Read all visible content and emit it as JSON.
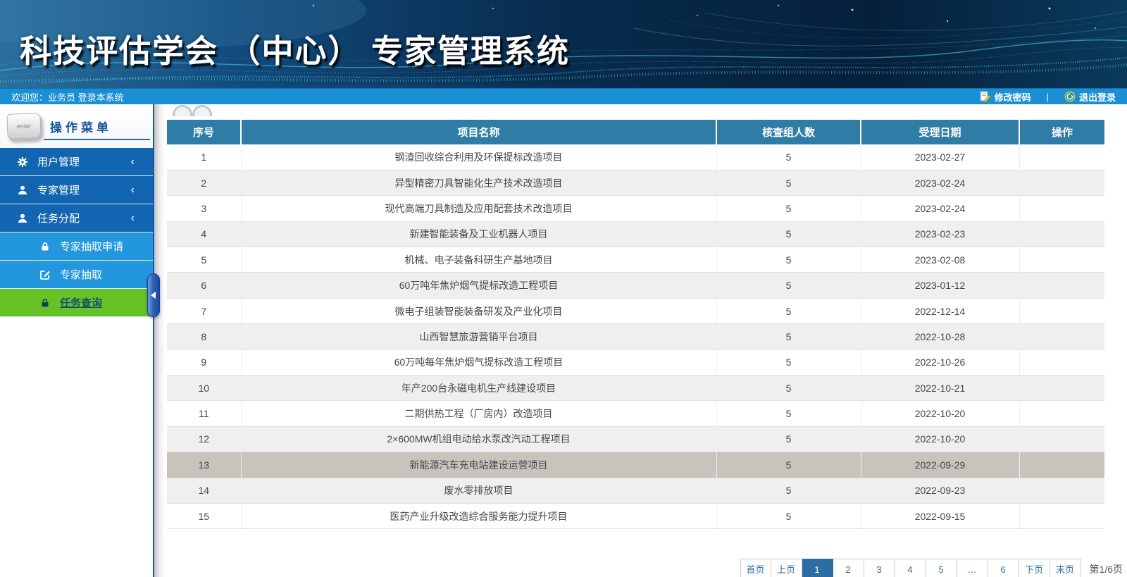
{
  "banner": {
    "title": "科技评估学会 （中心） 专家管理系统"
  },
  "topbar": {
    "welcome": "欢迎您：业务员 登录本系统",
    "change_password": "修改密码",
    "separator": "|",
    "logout": "退出登录"
  },
  "sidebar": {
    "header": "操作菜单",
    "enter_key_label": "enter",
    "menu": [
      {
        "label": "用户管理",
        "icon": "gear-icon",
        "chevron": "‹"
      },
      {
        "label": "专家管理",
        "icon": "user-icon",
        "chevron": "‹"
      },
      {
        "label": "任务分配",
        "icon": "user-icon",
        "chevron": "‹"
      },
      {
        "label": "专家抽取申请",
        "icon": "lock-icon"
      },
      {
        "label": "专家抽取",
        "icon": "edit-icon"
      },
      {
        "label": "任务查询",
        "icon": "lock-icon",
        "active": true
      }
    ]
  },
  "table": {
    "columns": [
      "序号",
      "项目名称",
      "核查组人数",
      "受理日期",
      "操作"
    ],
    "rows": [
      {
        "no": "1",
        "name": "钢渣回收综合利用及环保提标改造项目",
        "team": "5",
        "date": "2023-02-27",
        "op": ""
      },
      {
        "no": "2",
        "name": "异型精密刀具智能化生产技术改造项目",
        "team": "5",
        "date": "2023-02-24",
        "op": ""
      },
      {
        "no": "3",
        "name": "现代高端刀具制造及应用配套技术改造项目",
        "team": "5",
        "date": "2023-02-24",
        "op": ""
      },
      {
        "no": "4",
        "name": "新建智能装备及工业机器人项目",
        "team": "5",
        "date": "2023-02-23",
        "op": ""
      },
      {
        "no": "5",
        "name": "机械、电子装备科研生产基地项目",
        "team": "5",
        "date": "2023-02-08",
        "op": ""
      },
      {
        "no": "6",
        "name": "60万吨年焦炉烟气提标改造工程项目",
        "team": "5",
        "date": "2023-01-12",
        "op": ""
      },
      {
        "no": "7",
        "name": "微电子组装智能装备研发及产业化项目",
        "team": "5",
        "date": "2022-12-14",
        "op": ""
      },
      {
        "no": "8",
        "name": "山西智慧旅游营销平台项目",
        "team": "5",
        "date": "2022-10-28",
        "op": ""
      },
      {
        "no": "9",
        "name": "60万吨每年焦炉烟气提标改造工程项目",
        "team": "5",
        "date": "2022-10-26",
        "op": ""
      },
      {
        "no": "10",
        "name": "年产200台永磁电机生产线建设项目",
        "team": "5",
        "date": "2022-10-21",
        "op": ""
      },
      {
        "no": "11",
        "name": "二期供热工程（厂房内）改造项目",
        "team": "5",
        "date": "2022-10-20",
        "op": ""
      },
      {
        "no": "12",
        "name": "2×600MW机组电动给水泵改汽动工程项目",
        "team": "5",
        "date": "2022-10-20",
        "op": ""
      },
      {
        "no": "13",
        "name": "新能源汽车充电站建设运营项目",
        "team": "5",
        "date": "2022-09-29",
        "op": "",
        "cls": "highlight"
      },
      {
        "no": "14",
        "name": "废水零排放项目",
        "team": "5",
        "date": "2022-09-23",
        "op": ""
      },
      {
        "no": "15",
        "name": "医药产业升级改造综合服务能力提升项目",
        "team": "5",
        "date": "2022-09-15",
        "op": ""
      }
    ]
  },
  "pagination": {
    "items": [
      {
        "label": "首页"
      },
      {
        "label": "上页"
      },
      {
        "label": "1",
        "cls": "active"
      },
      {
        "label": "2"
      },
      {
        "label": "3"
      },
      {
        "label": "4"
      },
      {
        "label": "5"
      },
      {
        "label": "…"
      },
      {
        "label": "6"
      },
      {
        "label": "下页"
      },
      {
        "label": "末页"
      }
    ],
    "summary": "第1/6页"
  },
  "colors": {
    "topbar_blue": "#1b8fd3",
    "menu_blue": "#1266b1",
    "submenu_blue": "#2397de",
    "active_green": "#67c226",
    "table_header_blue": "#2f7ca7",
    "row_alt_gray": "#efefef",
    "row_highlight": "#c8c4bc",
    "pager_active_blue": "#2e6da4"
  }
}
